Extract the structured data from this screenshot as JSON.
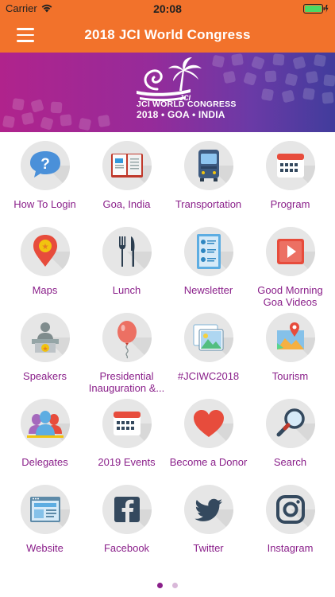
{
  "status_bar": {
    "carrier": "Carrier",
    "time": "20:08"
  },
  "header": {
    "title": "2018 JCI World Congress"
  },
  "banner": {
    "line1": "JCI WORLD CONGRESS",
    "line2": "2018 • GOA • INDIA",
    "mark": "JCI"
  },
  "tiles": [
    {
      "label": "How To Login",
      "icon": "question-bubble-icon"
    },
    {
      "label": "Goa, India",
      "icon": "open-book-icon"
    },
    {
      "label": "Transportation",
      "icon": "bus-icon"
    },
    {
      "label": "Program",
      "icon": "calendar-icon"
    },
    {
      "label": "Maps",
      "icon": "map-pin-icon"
    },
    {
      "label": "Lunch",
      "icon": "fork-knife-icon"
    },
    {
      "label": "Newsletter",
      "icon": "newsletter-icon"
    },
    {
      "label": "Good Morning Goa Videos",
      "icon": "play-video-icon"
    },
    {
      "label": "Speakers",
      "icon": "speaker-podium-icon"
    },
    {
      "label": "Presidential Inauguration &...",
      "icon": "balloon-icon"
    },
    {
      "label": "#JCIWC2018",
      "icon": "photo-gallery-icon"
    },
    {
      "label": "Tourism",
      "icon": "tourism-map-icon"
    },
    {
      "label": "Delegates",
      "icon": "people-group-icon"
    },
    {
      "label": "2019 Events",
      "icon": "events-calendar-icon"
    },
    {
      "label": "Become a Donor",
      "icon": "heart-icon"
    },
    {
      "label": "Search",
      "icon": "magnifier-icon"
    },
    {
      "label": "Website",
      "icon": "website-icon"
    },
    {
      "label": "Facebook",
      "icon": "facebook-icon"
    },
    {
      "label": "Twitter",
      "icon": "twitter-icon"
    },
    {
      "label": "Instagram",
      "icon": "instagram-icon"
    }
  ],
  "pager": {
    "total": 2,
    "current": 1
  },
  "colors": {
    "accent": "#f2722b",
    "label": "#8a1f8a",
    "circle": "#e6e6e6"
  }
}
